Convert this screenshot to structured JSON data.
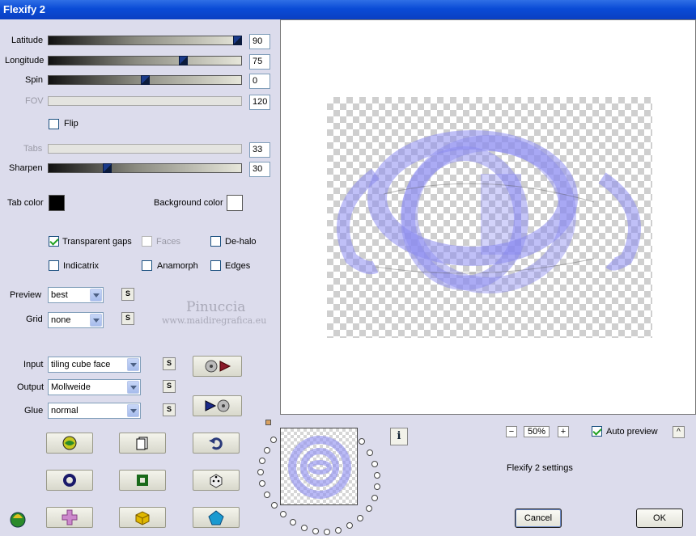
{
  "window": {
    "title": "Flexify 2"
  },
  "sliders": [
    {
      "label": "Latitude",
      "value": "90",
      "fraction": 1.0,
      "enabled": true
    },
    {
      "label": "Longitude",
      "value": "75",
      "fraction": 0.7,
      "enabled": true
    },
    {
      "label": "Spin",
      "value": "0",
      "fraction": 0.5,
      "enabled": true
    },
    {
      "label": "FOV",
      "value": "120",
      "fraction": null,
      "enabled": false
    },
    {
      "label": "Tabs",
      "value": "33",
      "fraction": null,
      "enabled": false
    },
    {
      "label": "Sharpen",
      "value": "30",
      "fraction": 0.3,
      "enabled": true
    }
  ],
  "flip": {
    "label": "Flip",
    "checked": false
  },
  "colors": {
    "tab_color_label": "Tab color",
    "tab_color": "#000000",
    "background_color_label": "Background color",
    "background_color": "#ffffff"
  },
  "options": [
    {
      "label": "Transparent gaps",
      "checked": true,
      "enabled": true
    },
    {
      "label": "Faces",
      "checked": false,
      "enabled": false
    },
    {
      "label": "De-halo",
      "checked": false,
      "enabled": true
    },
    {
      "label": "Indicatrix",
      "checked": false,
      "enabled": true
    },
    {
      "label": "Anamorph",
      "checked": false,
      "enabled": true
    },
    {
      "label": "Edges",
      "checked": false,
      "enabled": true
    }
  ],
  "preview_select": {
    "label": "Preview",
    "value": "best"
  },
  "grid_select": {
    "label": "Grid",
    "value": "none"
  },
  "input_select": {
    "label": "Input",
    "value": "tiling cube face"
  },
  "output_select": {
    "label": "Output",
    "value": "Mollweide"
  },
  "glue_select": {
    "label": "Glue",
    "value": "normal"
  },
  "small_button_label": "S",
  "watermark": {
    "name": "Pinuccia",
    "url": "www.maidiregrafica.eu"
  },
  "zoom": {
    "value": "50%",
    "minus": "−",
    "plus": "+"
  },
  "auto_preview": {
    "label": "Auto preview",
    "checked": true,
    "toggle": "^"
  },
  "settings_label": "Flexify 2 settings",
  "cancel_label": "Cancel",
  "ok_label": "OK",
  "info_label": "i",
  "accent_blue": "#7b7bf0"
}
